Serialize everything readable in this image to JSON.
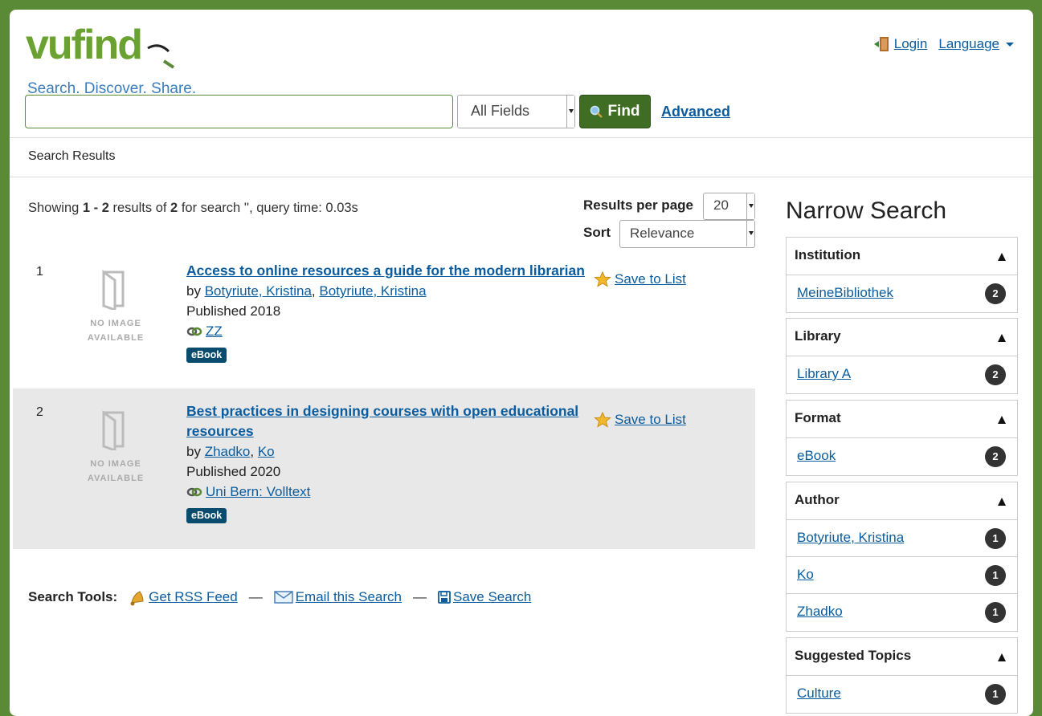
{
  "header": {
    "logo_text": "vufind",
    "tagline": "Search. Discover. Share.",
    "login_label": "Login",
    "language_label": "Language"
  },
  "search": {
    "query": "",
    "type": "All Fields",
    "find_label": "Find",
    "advanced_label": "Advanced"
  },
  "breadcrumb": "Search Results",
  "results_info": {
    "prefix": "Showing ",
    "range": "1 - 2",
    "mid": " results of ",
    "total": "2",
    "suffix": " for search '', query time: 0.03s",
    "rpp_label": "Results per page",
    "rpp_value": "20",
    "sort_label": "Sort",
    "sort_value": "Relevance"
  },
  "results": [
    {
      "num": "1",
      "title": "Access to online resources a guide for the modern librarian",
      "by": "by ",
      "authors": [
        "Botyriute, Kristina",
        "Botyriute, Kristina"
      ],
      "published": "Published 2018",
      "link": "ZZ",
      "format": "eBook",
      "save_label": "Save to List",
      "no_image_1": "NO IMAGE",
      "no_image_2": "AVAILABLE"
    },
    {
      "num": "2",
      "title": "Best practices in designing courses with open educational resources",
      "by": "by ",
      "authors": [
        "Zhadko",
        "Ko"
      ],
      "published": "Published 2020",
      "link": "Uni Bern: Volltext",
      "format": "eBook",
      "save_label": "Save to List",
      "no_image_1": "NO IMAGE",
      "no_image_2": "AVAILABLE"
    }
  ],
  "search_tools": {
    "label": "Search Tools:",
    "rss": "Get RSS Feed",
    "email": "Email this Search",
    "save": "Save Search",
    "sep": "—"
  },
  "narrow": {
    "title": "Narrow Search",
    "facets": [
      {
        "name": "Institution",
        "items": [
          {
            "label": "MeineBibliothek",
            "count": "2"
          }
        ]
      },
      {
        "name": "Library",
        "items": [
          {
            "label": "Library A",
            "count": "2"
          }
        ]
      },
      {
        "name": "Format",
        "items": [
          {
            "label": "eBook",
            "count": "2"
          }
        ]
      },
      {
        "name": "Author",
        "items": [
          {
            "label": "Botyriute, Kristina",
            "count": "1"
          },
          {
            "label": "Ko",
            "count": "1"
          },
          {
            "label": "Zhadko",
            "count": "1"
          }
        ]
      },
      {
        "name": "Suggested Topics",
        "items": [
          {
            "label": "Culture",
            "count": "1"
          }
        ]
      }
    ]
  },
  "colors": {
    "background": "#5a8a35",
    "find_button": "#3f6d24",
    "link": "#0a5c9e",
    "badge": "#094c6e"
  }
}
